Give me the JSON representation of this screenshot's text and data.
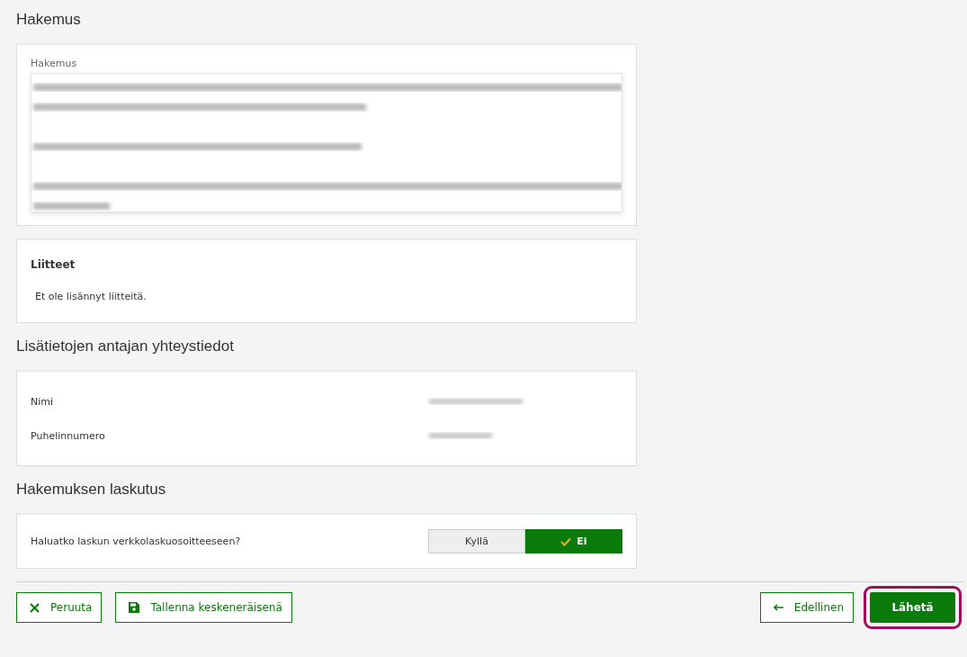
{
  "sections": [
    {
      "kind": "textarea",
      "heading": "Hakemus",
      "label": "Hakemus"
    },
    {
      "kind": "attachments",
      "title": "Liitteet",
      "text": "Et ole lisännyt liitteitä."
    },
    {
      "kind": "contact",
      "heading": "Lisätietojen antajan yhteystiedot",
      "fields": [
        {
          "label": "Nimi"
        },
        {
          "label": "Puhelinnumero"
        }
      ]
    },
    {
      "kind": "toggle",
      "heading": "Hakemuksen laskutus",
      "question": "Haluatko laskun verkkolaskuosoitteeseen?",
      "options": [
        {
          "label": "Kyllä",
          "selected": false
        },
        {
          "label": "Ei",
          "selected": true
        }
      ]
    }
  ],
  "footer": {
    "left": [
      {
        "label": "Peruuta",
        "kind": "cancel"
      },
      {
        "label": "Tallenna keskeneräisenä",
        "kind": "save"
      }
    ],
    "right": [
      {
        "label": "Edellinen",
        "kind": "back",
        "primary": false,
        "focused": false
      },
      {
        "label": "Lähetä",
        "kind": "send",
        "primary": true,
        "focused": true
      }
    ]
  }
}
